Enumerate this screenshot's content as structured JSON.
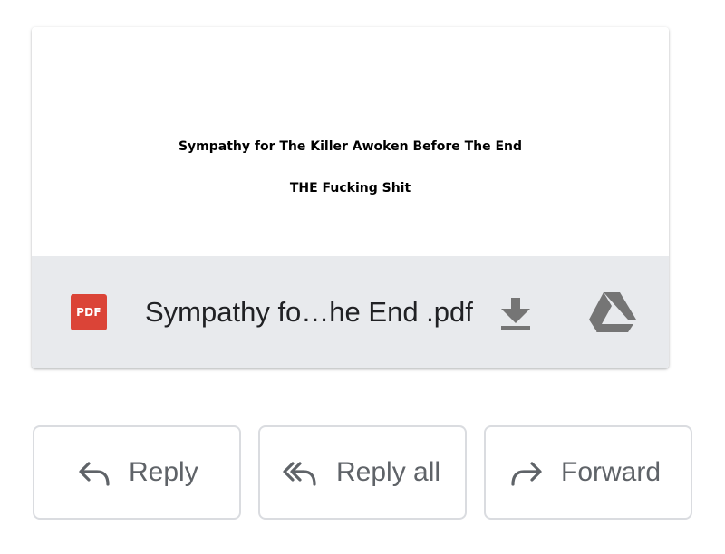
{
  "attachment": {
    "preview_lines": [
      "Sympathy for The Killer Awoken Before The End",
      "THE Fucking Shit"
    ],
    "file_type_badge": "PDF",
    "file_name": "Sympathy fo…he End .pdf",
    "icons": {
      "file_type": "pdf-file-icon",
      "download": "download-icon",
      "drive": "google-drive-icon"
    },
    "colors": {
      "pdf_badge": "#db4437",
      "footer_bg": "#e8eaed",
      "icon_gray": "#757575"
    }
  },
  "actions": [
    {
      "label": "Reply",
      "icon": "reply-icon"
    },
    {
      "label": "Reply all",
      "icon": "reply-all-icon"
    },
    {
      "label": "Forward",
      "icon": "forward-icon"
    }
  ]
}
